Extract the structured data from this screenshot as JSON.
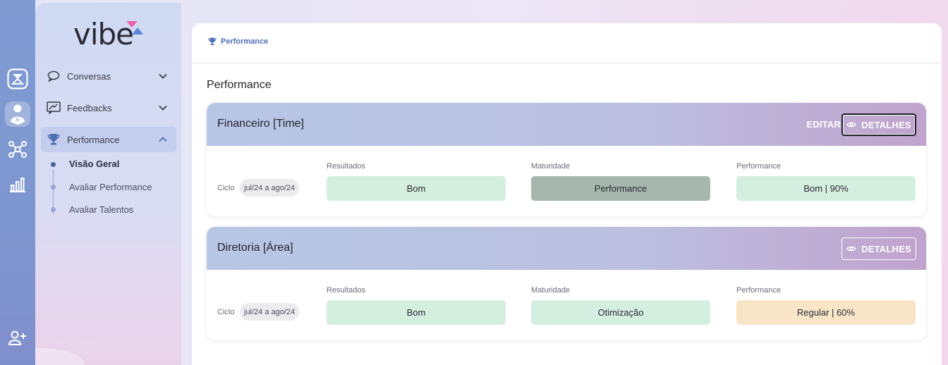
{
  "app": {
    "logo": "vibe"
  },
  "colors": {
    "good": "#d4eedf",
    "maturity_performance": "#a6b8ad",
    "regular": "#f8e5c8",
    "accent_pink": "#ee5fa8",
    "accent_blue": "#4d6fb3"
  },
  "rail": {
    "icons": [
      "hourglass-icon",
      "ai-assistant-icon",
      "network-icon",
      "bar-chart-icon",
      "add-user-icon"
    ]
  },
  "sidebar": {
    "menu": [
      {
        "label": "Conversas",
        "icon": "chat-bubble-icon"
      },
      {
        "label": "Feedbacks",
        "icon": "feedback-icon"
      },
      {
        "label": "Performance",
        "icon": "trophy-icon"
      }
    ],
    "submenu": [
      {
        "label": "Visão Geral"
      },
      {
        "label": "Avaliar Performance"
      },
      {
        "label": "Avaliar Talentos"
      }
    ]
  },
  "breadcrumb": {
    "label": "Performance"
  },
  "page": {
    "title": "Performance"
  },
  "labels": {
    "edit": "EDITAR",
    "details": "DETALHES",
    "ciclo": "Ciclo",
    "resultados": "Resultados",
    "maturidade": "Maturidade",
    "performance": "Performance"
  },
  "cards": [
    {
      "title": "Financeiro [Time]",
      "cycle": "jul/24 a ago/24",
      "resultados": "Bom",
      "maturidade": "Performance",
      "performance": "Bom | 90%"
    },
    {
      "title": "Diretoria [Área]",
      "cycle": "jul/24 a ago/24",
      "resultados": "Bom",
      "maturidade": "Otimização",
      "performance": "Regular | 60%"
    }
  ]
}
